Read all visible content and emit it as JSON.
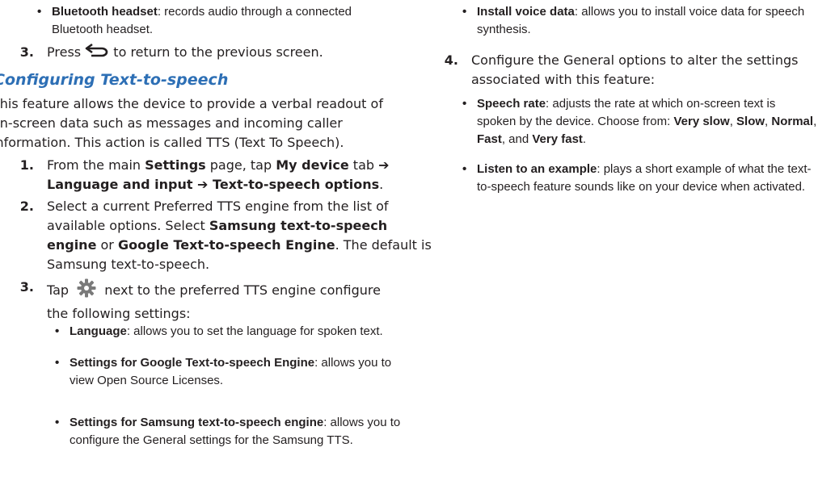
{
  "left": {
    "bullet_bt": {
      "term": "Bluetooth headset",
      "desc_line1": ": records audio through a connected",
      "desc_line2": "Bluetooth headset."
    },
    "step3_return": {
      "num": "3.",
      "before": "Press",
      "after": "to return to the previous screen.",
      "icon": "back-arrow-icon"
    },
    "section_heading": "Configuring Text-to-speech",
    "intro": {
      "line1": "This feature allows the device to provide a verbal readout of",
      "line2": "on-screen data such as messages and incoming caller",
      "line3": "information. This action is called TTS (Text To Speech)."
    },
    "step1": {
      "num": "1.",
      "t1": "From the main ",
      "b1": "Settings",
      "t2": " page, tap ",
      "b2": "My device",
      "t3": " tab ➔",
      "b3": "Language and input",
      "t4": " ➔ ",
      "b4": "Text-to-speech options",
      "t5": "."
    },
    "step2": {
      "num": "2.",
      "line1": "Select a current Preferred TTS engine from the list of",
      "line2a": "available options. Select ",
      "line2b": "Samsung text-to-speech",
      "line3a": "engine",
      "line3b": " or ",
      "line3c": "Google Text-to-speech Engine",
      "line3d": ". The default is",
      "line4": "Samsung text-to-speech."
    },
    "step3_tap": {
      "num": "3.",
      "before": "Tap",
      "after": "next to the preferred TTS engine configure",
      "line2": "the following settings:",
      "icon": "gear-icon"
    },
    "bullet_language": {
      "term": "Language",
      "desc": ": allows you to set the language for spoken text."
    },
    "bullet_google": {
      "term": "Settings for Google Text-to-speech Engine",
      "desc": ": allows you to",
      "line2": "view Open Source Licenses."
    },
    "bullet_samsung": {
      "term": "Settings for Samsung text-to-speech engine",
      "desc": ": allows you to",
      "line2": "configure the General settings for the Samsung TTS."
    }
  },
  "right": {
    "bullet_voice": {
      "term": "Install voice data",
      "desc": ": allows you to install voice data for speech",
      "line2": "synthesis."
    },
    "step4": {
      "num": "4.",
      "line1": "Configure the General options to alter the settings",
      "line2": "associated with this feature:"
    },
    "bullet_rate": {
      "term": "Speech rate",
      "desc": ": adjusts the rate at which on-screen text is",
      "line2a": "spoken by the device. Choose from: ",
      "opt1": "Very slow",
      "sep1": ", ",
      "opt2": "Slow",
      "sep2": ", ",
      "opt3": "Normal",
      "sep3": ",",
      "opt4": "Fast",
      "sep4": ", and ",
      "opt5": "Very fast",
      "end": "."
    },
    "bullet_listen": {
      "term": "Listen to an example",
      "desc": ": plays a short example of what the text-",
      "line2": "to-speech feature sounds like on your device when activated."
    }
  },
  "colors": {
    "heading": "#2d6fb5",
    "text": "#231f20",
    "gear": "#7a7a7a"
  }
}
